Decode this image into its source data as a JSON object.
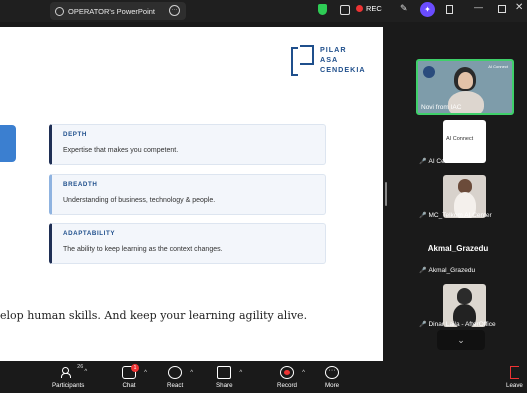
{
  "window": {
    "tab_title": "OPERATOR's PowerPoint",
    "rec_label": "REC"
  },
  "slide": {
    "logo_lines": [
      "PILAR",
      "ASA",
      "CENDEKIA"
    ],
    "cards": [
      {
        "title": "DEPTH",
        "body": "Expertise that makes you competent."
      },
      {
        "title": "BREADTH",
        "body": "Understanding of business, technology & people."
      },
      {
        "title": "ADAPTABILITY",
        "body": "The ability to keep learning as the context changes."
      }
    ],
    "quote": "elop human skills. And keep your learning agility alive."
  },
  "participants_panel": {
    "tile_main": {
      "name": "Novi from IAC",
      "tag": "AI Connect"
    },
    "tile_white": {
      "name": "AI Center Bali",
      "logo_text": "AI Connect"
    },
    "tile_2": {
      "name": "MC_Telkom AI Center"
    },
    "speaker_name": "Akmal_Grazedu",
    "tile_speaker": {
      "name": "Akmal_Grazedu"
    },
    "tile_3": {
      "name": "Dinar Laila - AfterOffice"
    }
  },
  "toolbar": {
    "participants_label": "Participants",
    "participants_count": "26",
    "chat_label": "Chat",
    "chat_badge": "1",
    "react_label": "React",
    "share_label": "Share",
    "record_label": "Record",
    "more_label": "More",
    "leave_label": "Leave"
  }
}
